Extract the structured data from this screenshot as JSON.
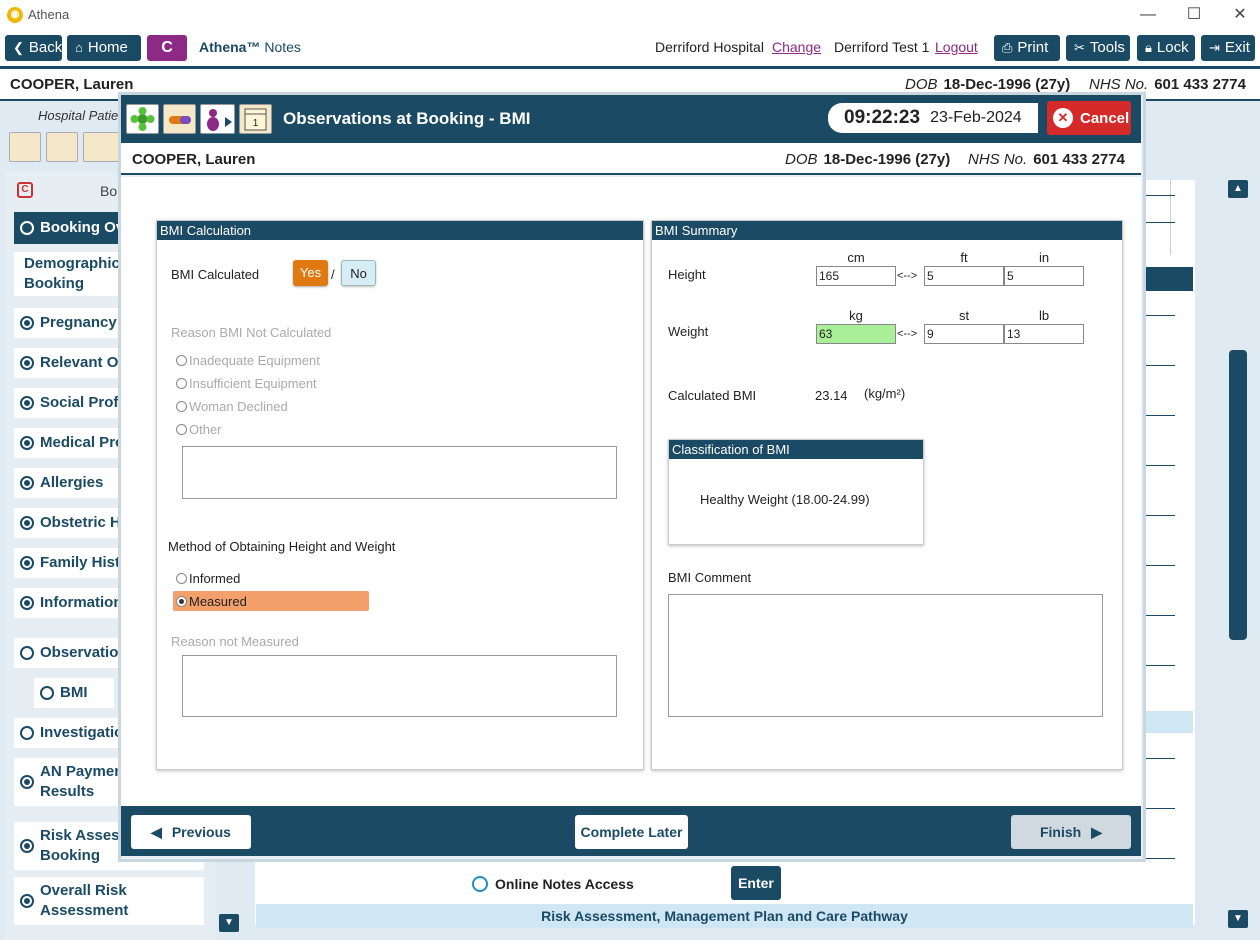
{
  "window": {
    "title": "Athena",
    "minimize": "—",
    "maximize": "☐",
    "close": "✕"
  },
  "toolbar": {
    "back": "Back",
    "home": "Home",
    "c_badge": "C",
    "app_name": "Athena™",
    "app_suffix": "Notes",
    "hospital": "Derriford Hospital",
    "change": "Change",
    "user": "Derriford Test 1",
    "logout": "Logout",
    "print": "Print",
    "tools": "Tools",
    "lock": "Lock",
    "exit": "Exit"
  },
  "patient": {
    "name": "COOPER, Lauren",
    "dob_label": "DOB",
    "dob": "18-Dec-1996 (27y)",
    "nhs_label": "NHS No.",
    "nhs": "601 433 2774"
  },
  "background": {
    "hospital_sub": "Hospital Patie",
    "bo": "Bo",
    "online_notes": "Online Notes Access",
    "enter": "Enter",
    "risk_bar": "Risk Assessment, Management Plan and Care Pathway",
    "sidebar": [
      {
        "label": "Booking Ov",
        "state": "sel"
      },
      {
        "label": "Demographics",
        "line2": "Booking",
        "state": "none"
      },
      {
        "label": "Pregnancy I",
        "state": "f"
      },
      {
        "label": "Relevant Ot",
        "state": "f"
      },
      {
        "label": "Social Profil",
        "state": "f"
      },
      {
        "label": "Medical Pro",
        "state": "f"
      },
      {
        "label": "Allergies",
        "state": "f"
      },
      {
        "label": "Obstetric H",
        "state": "f"
      },
      {
        "label": "Family Histo",
        "state": "f"
      },
      {
        "label": "Information",
        "state": "f"
      },
      {
        "label": "Observation",
        "state": "e"
      },
      {
        "label": "BMI",
        "state": "e"
      },
      {
        "label": "Investigatio",
        "state": "e"
      },
      {
        "label": "AN Paymen",
        "line2": "Results",
        "state": "h"
      },
      {
        "label": "Risk Assessi",
        "line2": "Booking",
        "state": "f"
      },
      {
        "label": "Overall Risk",
        "line2": "Assessment",
        "state": "f"
      }
    ]
  },
  "modal": {
    "title": "Observations at Booking - BMI",
    "time": "09:22:23",
    "date": "23-Feb-2024",
    "cancel": "Cancel",
    "calendar_num": "1"
  },
  "bmi_calc": {
    "header": "BMI Calculation",
    "calculated_label": "BMI Calculated",
    "yes": "Yes",
    "slash": "/",
    "no": "No",
    "selected": "Yes",
    "reason_label": "Reason BMI Not Calculated",
    "reasons": [
      "Inadequate Equipment",
      "Insufficient Equipment",
      "Woman Declined",
      "Other"
    ],
    "method_label": "Method of Obtaining Height and Weight",
    "methods": [
      "Informed",
      "Measured"
    ],
    "method_selected": "Measured",
    "reason_not_measured": "Reason not Measured"
  },
  "bmi_summary": {
    "header": "BMI Summary",
    "height_label": "Height",
    "weight_label": "Weight",
    "units_height": [
      "cm",
      "ft",
      "in"
    ],
    "units_weight": [
      "kg",
      "st",
      "lb"
    ],
    "conv": "<-->",
    "height": {
      "cm": "165",
      "ft": "5",
      "in": "5"
    },
    "weight": {
      "kg": "63",
      "st": "9",
      "lb": "13"
    },
    "calc_label": "Calculated BMI",
    "bmi_value": "23.14",
    "bmi_unit": "(kg/m²)",
    "classification_header": "Classification of BMI",
    "classification": "Healthy Weight (18.00-24.99)",
    "comment_label": "BMI Comment"
  },
  "footer": {
    "previous": "Previous",
    "complete_later": "Complete Later",
    "finish": "Finish"
  },
  "colors": {
    "navy": "#1b4a64",
    "orange": "#e07a10",
    "salmon": "#f4a06c",
    "green_field": "#a8ef98",
    "cancel_red": "#d52a2a",
    "purple": "#8c2a86"
  }
}
